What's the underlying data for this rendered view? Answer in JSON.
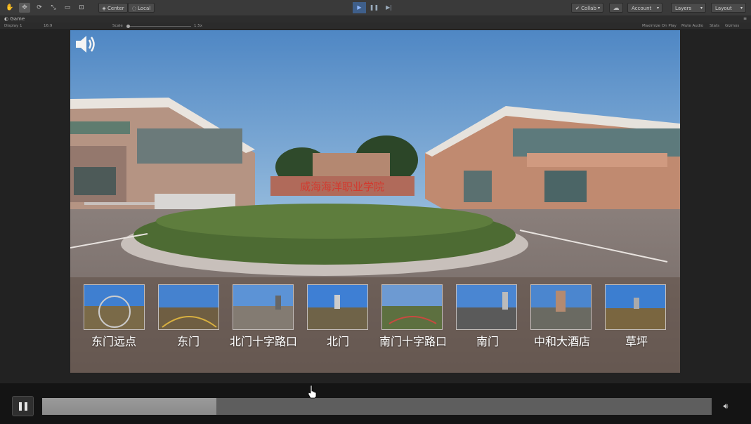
{
  "toolbar": {
    "pivot_label": "Center",
    "space_label": "Local",
    "collab_label": "Collab",
    "account_label": "Account",
    "layers_label": "Layers",
    "layout_label": "Layout"
  },
  "game_view": {
    "tab_title": "Game",
    "display": "Display 1",
    "aspect": "16:9",
    "scale_label": "Scale",
    "scale_value": "1.5x",
    "maximize_label": "Maximize On Play",
    "mute_label": "Mute Audio",
    "stats_label": "Stats",
    "gizmos_label": "Gizmos"
  },
  "scene": {
    "sign_text": "威海海洋职业学院"
  },
  "thumbnails": [
    {
      "label": "东门远点"
    },
    {
      "label": "东门"
    },
    {
      "label": "北门十字路口"
    },
    {
      "label": "北门"
    },
    {
      "label": "南门十字路口"
    },
    {
      "label": "南门"
    },
    {
      "label": "中和大酒店"
    },
    {
      "label": "草坪"
    }
  ],
  "player": {
    "progress_fraction": 0.26
  }
}
